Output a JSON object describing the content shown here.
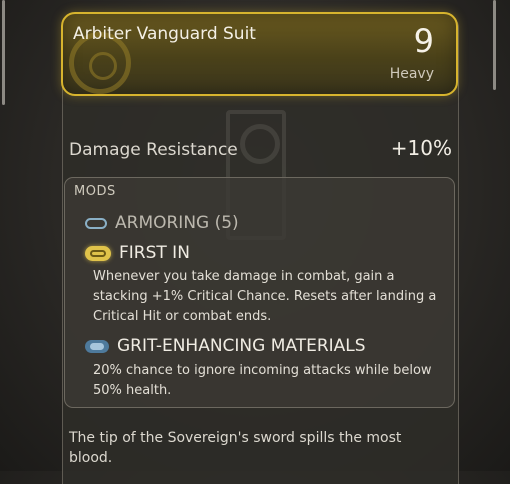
{
  "item": {
    "name": "Arbiter Vanguard Suit",
    "level": "9",
    "class": "Heavy"
  },
  "stat": {
    "label": "Damage Resistance",
    "value": "+10%"
  },
  "mods": {
    "title": "MODS",
    "slots": [
      {
        "name": "ARMORING (5)",
        "icon": "armoring-slot-icon",
        "description": ""
      },
      {
        "name": "FIRST IN",
        "icon": "legendary-mod-icon",
        "description": "Whenever you take damage in combat, gain a stacking +1% Critical Chance. Resets after landing a Critical Hit or combat ends."
      },
      {
        "name": "GRIT-ENHANCING MATERIALS",
        "icon": "rare-mod-icon",
        "description": "20% chance to ignore incoming attacks while below 50% health."
      }
    ]
  },
  "flavor_text": "The tip of the Sovereign's sword spills the most blood.",
  "colors": {
    "legendary_gold": "#d7b42e",
    "mod_blue": "#4e7a9c",
    "panel_bg": "#2e2c28"
  }
}
